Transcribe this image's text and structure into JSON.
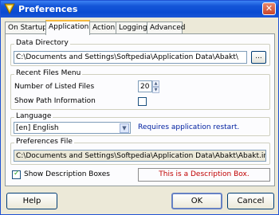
{
  "window": {
    "title": "Preferences",
    "close_glyph": "✕"
  },
  "tabs": [
    {
      "label": "On Startup"
    },
    {
      "label": "Application",
      "active": true
    },
    {
      "label": "Action"
    },
    {
      "label": "Logging"
    },
    {
      "label": "Advanced"
    }
  ],
  "data_directory": {
    "legend": "Data Directory",
    "value": "C:\\Documents and Settings\\Softpedia\\Application Data\\Abakt\\",
    "browse_label": "..."
  },
  "recent_files": {
    "legend": "Recent Files Menu",
    "listed_label": "Number of Listed Files",
    "listed_value": "20",
    "show_path_label": "Show Path Information",
    "show_path_checked": false
  },
  "language": {
    "legend": "Language",
    "selected": "[en] English",
    "note": "Requires application restart."
  },
  "preferences_file": {
    "legend": "Preferences File",
    "value": "C:\\Documents and Settings\\Softpedia\\Application Data\\Abakt\\Abakt.ini"
  },
  "description": {
    "checkbox_label": "Show Description Boxes",
    "checked": true,
    "box_text": "This is a Description Box."
  },
  "buttons": {
    "help": "Help",
    "ok": "OK",
    "cancel": "Cancel"
  },
  "colors": {
    "title_bar": "#0a4bd2",
    "note_text": "#0020a0",
    "description_text": "#c00000"
  }
}
